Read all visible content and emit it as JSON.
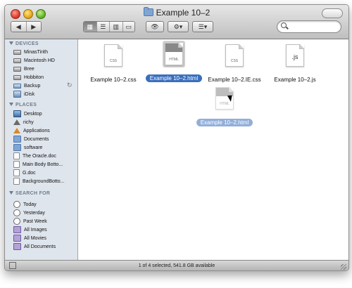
{
  "window": {
    "title": "Example 10–2"
  },
  "toolbar": {
    "back_icon": "◀",
    "forward_icon": "▶",
    "view_modes": [
      "▦",
      "☰",
      "▥",
      "▭"
    ],
    "quicklook_icon": "👁",
    "action_icon": "⚙▾",
    "arrange_icon": "☰▾"
  },
  "sidebar": {
    "devices_header": "DEVICES",
    "devices": [
      {
        "label": "MinasTirith",
        "icon": "disk-icon"
      },
      {
        "label": "Macintosh HD",
        "icon": "disk-icon"
      },
      {
        "label": "Bree",
        "icon": "disk-icon"
      },
      {
        "label": "Hobbiton",
        "icon": "disk-icon"
      },
      {
        "label": "Backup",
        "icon": "backup-disk-icon"
      },
      {
        "label": "iDisk",
        "icon": "idisk-icon"
      }
    ],
    "places_header": "PLACES",
    "places": [
      {
        "label": "Desktop",
        "icon": "desktop-icon"
      },
      {
        "label": "richy",
        "icon": "home-icon"
      },
      {
        "label": "Applications",
        "icon": "applications-icon"
      },
      {
        "label": "Documents",
        "icon": "folder-icon"
      },
      {
        "label": "software",
        "icon": "folder-icon"
      },
      {
        "label": "The Oracle.doc",
        "icon": "document-icon"
      },
      {
        "label": "Main Body Botto...",
        "icon": "document-icon"
      },
      {
        "label": "G.doc",
        "icon": "document-icon"
      },
      {
        "label": "BackgroundBotto...",
        "icon": "document-icon"
      }
    ],
    "search_header": "SEARCH FOR",
    "searches": [
      {
        "label": "Today",
        "icon": "clock-icon"
      },
      {
        "label": "Yesterday",
        "icon": "clock-icon"
      },
      {
        "label": "Past Week",
        "icon": "clock-icon"
      },
      {
        "label": "All Images",
        "icon": "smart-folder-icon"
      },
      {
        "label": "All Movies",
        "icon": "smart-folder-icon"
      },
      {
        "label": "All Documents",
        "icon": "smart-folder-icon"
      }
    ]
  },
  "files": [
    {
      "name": "Example 10–2.css",
      "type": "CSS",
      "selected": false
    },
    {
      "name": "Example 10–2.html",
      "type": "HTML",
      "selected": true
    },
    {
      "name": "Example 10–2.IE.css",
      "type": "CSS",
      "selected": false
    },
    {
      "name": "Example 10–2.js",
      "type": ".js",
      "selected": false
    }
  ],
  "drag_ghost": {
    "name": "Example 10–2.html",
    "type": "HTML"
  },
  "status": {
    "text": "1 of 4 selected, 541.8 GB available"
  },
  "colors": {
    "selection": "#3a6fbd",
    "sidebar_bg": "#dfe5ec",
    "header_text": "#6e7c8c"
  }
}
